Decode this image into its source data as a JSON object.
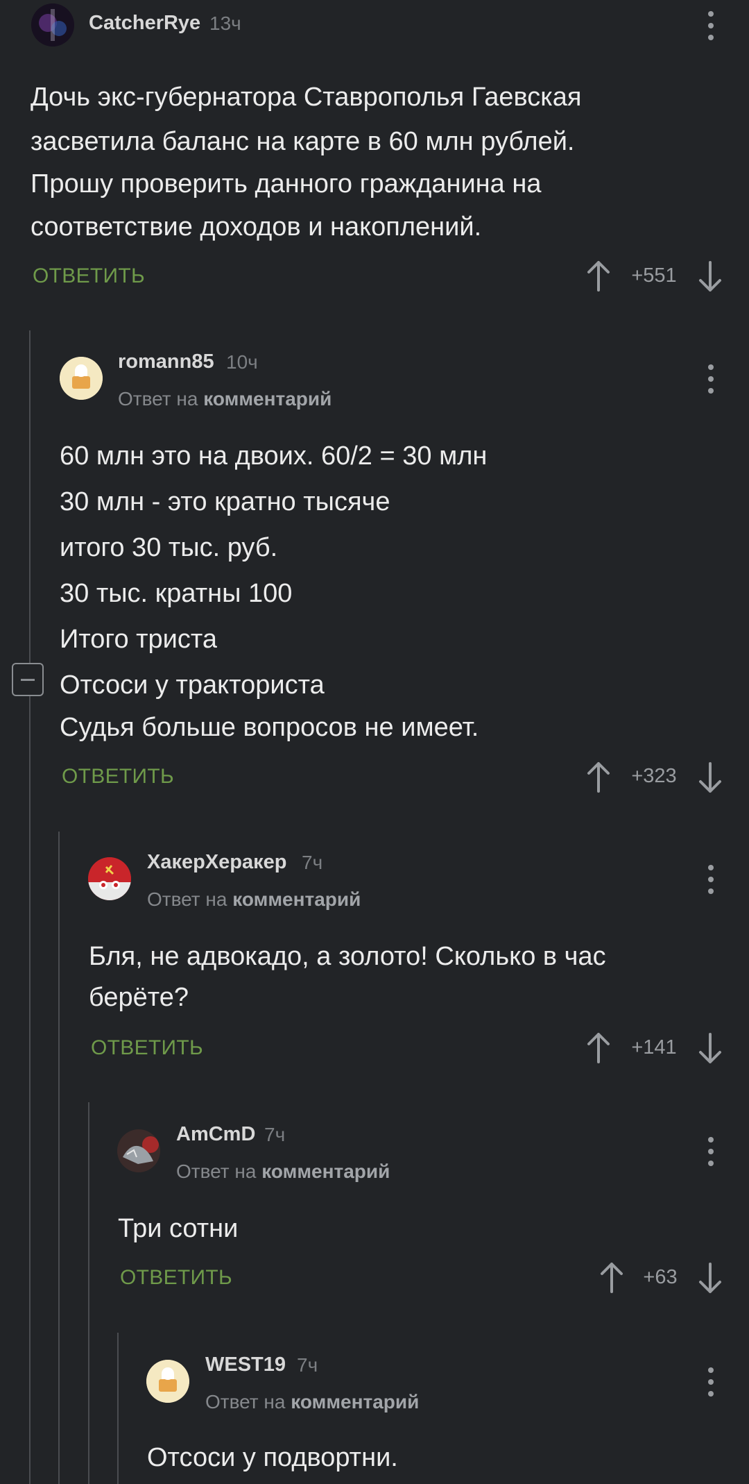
{
  "comments": [
    {
      "author": "CatcherRye",
      "time": "13ч",
      "lines": [
        "Дочь экс-губернатора Ставрополья Гаевская",
        "засветила баланс на карте в 60 млн рублей.",
        "Прошу проверить данного гражданина на",
        "соответствие доходов и накоплений."
      ],
      "reply_label": "ОТВЕТИТЬ",
      "score": "+551"
    },
    {
      "author": "romann85",
      "time": "10ч",
      "reply_prefix": "Ответ на",
      "reply_target": "комментарий",
      "lines": [
        "60 млн это на двоих. 60/2 = 30 млн",
        "30 млн - это кратно тысяче",
        "итого 30 тыс. руб.",
        "30 тыс. кратны 100",
        "Итого триста",
        "Отсоси у тракториста",
        "Судья больше вопросов не имеет."
      ],
      "reply_label": "ОТВЕТИТЬ",
      "score": "+323"
    },
    {
      "author": "ХакерХеракер",
      "time": "7ч",
      "reply_prefix": "Ответ на",
      "reply_target": "комментарий",
      "lines": [
        "Бля, не адвокадо, а золото! Сколько в час",
        "берёте?"
      ],
      "reply_label": "ОТВЕТИТЬ",
      "score": "+141"
    },
    {
      "author": "AmCmD",
      "time": "7ч",
      "reply_prefix": "Ответ на",
      "reply_target": "комментарий",
      "lines": [
        "Три сотни"
      ],
      "reply_label": "ОТВЕТИТЬ",
      "score": "+63"
    },
    {
      "author": "WEST19",
      "time": "7ч",
      "reply_prefix": "Ответ на",
      "reply_target": "комментарий",
      "lines": [
        "Отсоси у подвортни."
      ]
    }
  ],
  "icons": {
    "upvote": "arrow-up-icon",
    "downvote": "arrow-down-icon",
    "menu": "kebab-menu-icon",
    "collapse": "collapse-minus-icon"
  },
  "colors": {
    "background": "#222427",
    "reply_action": "#6f9a4a",
    "text": "#ececec",
    "muted": "#7c7f83"
  }
}
